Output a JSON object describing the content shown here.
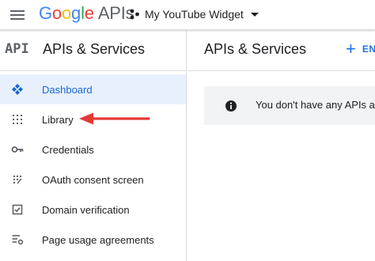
{
  "topbar": {
    "brand_letters": [
      "G",
      "o",
      "o",
      "g",
      "l",
      "e"
    ],
    "brand_suffix": "APIs",
    "project_name": "My YouTube Widget",
    "icons": {
      "menu": "hamburger-menu-icon",
      "project": "project-nodes-icon",
      "dropdown": "chevron-down-icon"
    }
  },
  "sidebar": {
    "logo_text": "API",
    "title": "APIs & Services",
    "items": [
      {
        "label": "Dashboard",
        "icon": "dashboard-icon",
        "active": true
      },
      {
        "label": "Library",
        "icon": "library-grid-icon",
        "active": false
      },
      {
        "label": "Credentials",
        "icon": "key-icon",
        "active": false
      },
      {
        "label": "OAuth consent screen",
        "icon": "consent-dots-icon",
        "active": false
      },
      {
        "label": "Domain verification",
        "icon": "checkbox-icon",
        "active": false
      },
      {
        "label": "Page usage agreements",
        "icon": "settings-list-icon",
        "active": false
      }
    ]
  },
  "main": {
    "title": "APIs & Services",
    "enable_button": {
      "symbol": "+",
      "label": "EN"
    },
    "notice": {
      "icon": "info-icon",
      "text": "You don't have any APIs ava"
    }
  },
  "colors": {
    "accent": "#1a73e8",
    "active_bg": "#e8f0fe",
    "annotation_arrow": "#e53935",
    "notice_bg": "#f1f3f4"
  }
}
